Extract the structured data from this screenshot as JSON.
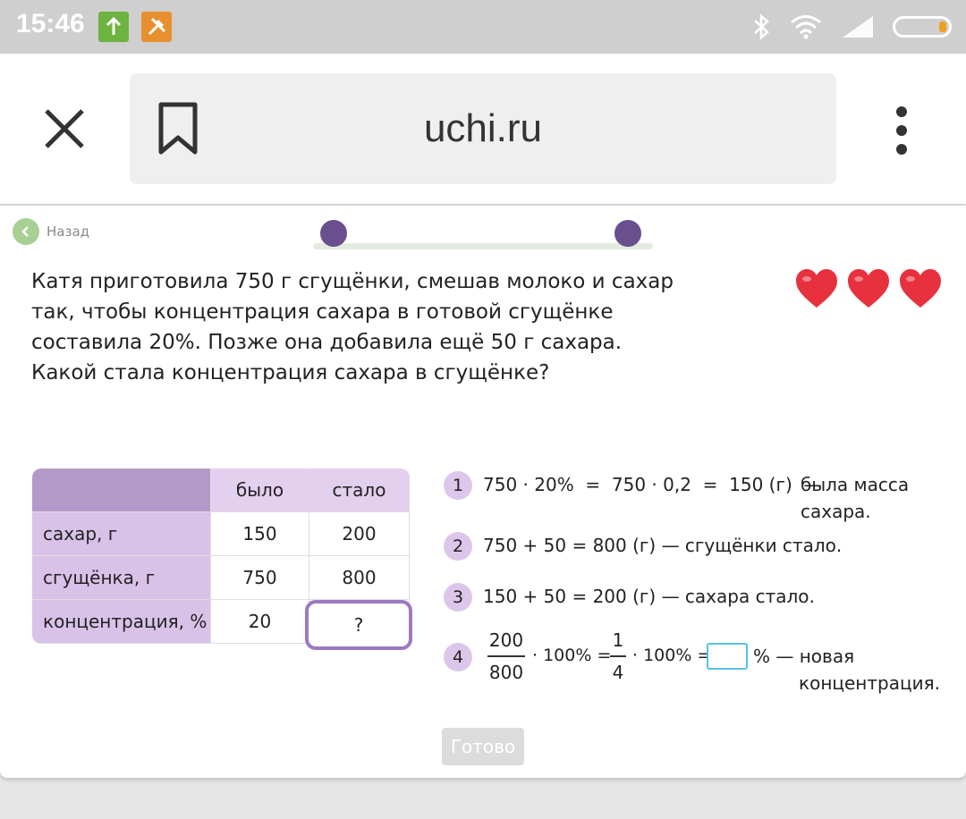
{
  "status_bar": {
    "time": "15:46",
    "icons": [
      "upload-icon",
      "paint-icon",
      "bluetooth-icon",
      "wifi-icon",
      "signal-icon",
      "battery-icon"
    ]
  },
  "browser": {
    "url": "uchi.ru",
    "icons": [
      "close-icon",
      "bookmark-icon",
      "more-vert-icon"
    ]
  },
  "nav": {
    "back_label": "Назад"
  },
  "problem": {
    "lines": [
      "Катя приготовила 750 г сгущёнки, смешав молоко и сахар",
      "так, чтобы концентрация сахара в готовой сгущёнке",
      "составила 20%. Позже она добавила ещё 50 г сахара.",
      "Какой стала концентрация сахара в сгущёнке?"
    ]
  },
  "lives": 3,
  "table": {
    "headers": [
      "",
      "было",
      "стало"
    ],
    "rows": [
      {
        "label": "сахар, г",
        "before": "150",
        "after": "200"
      },
      {
        "label": "сгущёнка, г",
        "before": "750",
        "after": "800"
      },
      {
        "label": "концентрация, %",
        "before": "20",
        "after": "?"
      }
    ]
  },
  "steps": [
    {
      "num": "1",
      "expr": "750 · 20%  =  750 · 0,2  =  150 (г)  —",
      "note_line1": "была масса",
      "note_line2": "сахара."
    },
    {
      "num": "2",
      "text": "750 + 50 = 800 (г) — сгущёнки стало."
    },
    {
      "num": "3",
      "text": "150 + 50 = 200 (г) — сахара стало."
    },
    {
      "num": "4",
      "frac1_num": "200",
      "frac1_den": "800",
      "mid1": "· 100% =",
      "frac2_num": "1",
      "frac2_den": "4",
      "mid2": "· 100% =",
      "unit": "% — новая",
      "note_line2": "концентрация."
    }
  ],
  "done_label": "Готово",
  "colors": {
    "accent_purple": "#6a4f8f",
    "table_header": "#e3cfee",
    "table_corner": "#b399c8",
    "table_label": "#d9c2e8",
    "input_border": "#5bbfe6",
    "heart_red": "#e8313f"
  }
}
